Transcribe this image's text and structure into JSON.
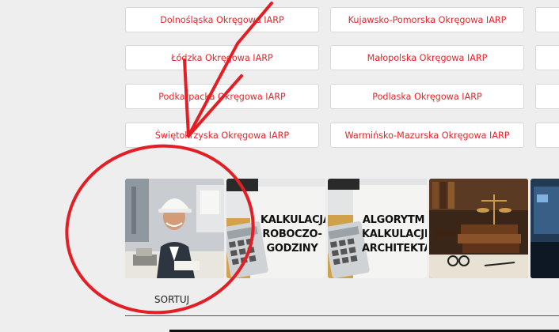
{
  "chambers": [
    {
      "label": "Dolnośląska Okręgowa IARP"
    },
    {
      "label": "Kujawsko-Pomorska Okręgowa IARP"
    },
    {
      "label": "Łódzka Okręgowa IARP"
    },
    {
      "label": "Małopolska Okręgowa IARP"
    },
    {
      "label": "Podkarpacka Okręgowa IARP"
    },
    {
      "label": "Podlaska Okręgowa IARP"
    },
    {
      "label": "Świętokrzyska Okręgowa IARP"
    },
    {
      "label": "Warmińsko-Mazurska Okręgowa IARP"
    }
  ],
  "thumbnails": [
    {
      "text": ""
    },
    {
      "text": "KALKULACJA ROBOCZO-GODZINY"
    },
    {
      "text": "ALGORYTM KALKULACJI ARCHITEKTA"
    },
    {
      "text": ""
    },
    {
      "text": ""
    }
  ],
  "sort_label": "SORTUJ",
  "colors": {
    "accent": "#e8242a",
    "annotation": "#e31e24"
  }
}
